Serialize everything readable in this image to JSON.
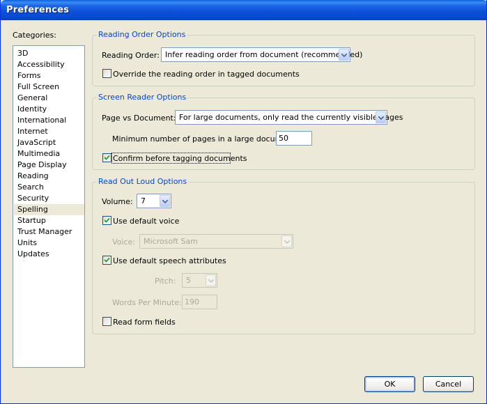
{
  "window": {
    "title": "Preferences"
  },
  "categories": {
    "label": "Categories:",
    "selected_index": 14,
    "items": [
      "3D",
      "Accessibility",
      "Forms",
      "Full Screen",
      "General",
      "Identity",
      "International",
      "Internet",
      "JavaScript",
      "Multimedia",
      "Page Display",
      "Reading",
      "Search",
      "Security",
      "Spelling",
      "Startup",
      "Trust Manager",
      "Units",
      "Updates"
    ]
  },
  "reading_order": {
    "group_title": "Reading Order Options",
    "label": "Reading Order:",
    "value": "Infer reading order from document (recommended)",
    "override_label": "Override the reading order in tagged documents",
    "override_checked": false
  },
  "screen_reader": {
    "group_title": "Screen Reader Options",
    "page_vs_doc_label": "Page vs Document:",
    "page_vs_doc_value": "For large documents, only read the currently visible pages",
    "min_pages_label": "Minimum number of pages in a large document:",
    "min_pages_value": "50",
    "confirm_label": "Confirm before tagging documents",
    "confirm_checked": true
  },
  "read_out_loud": {
    "group_title": "Read Out Loud Options",
    "volume_label": "Volume:",
    "volume_value": "7",
    "default_voice_label": "Use default voice",
    "default_voice_checked": true,
    "voice_label": "Voice:",
    "voice_value": "Microsoft Sam",
    "default_speech_label": "Use default speech attributes",
    "default_speech_checked": true,
    "pitch_label": "Pitch:",
    "pitch_value": "5",
    "wpm_label": "Words Per Minute:",
    "wpm_value": "190",
    "read_form_fields_label": "Read form fields",
    "read_form_fields_checked": false
  },
  "buttons": {
    "ok": "OK",
    "cancel": "Cancel"
  },
  "colors": {
    "title_bar": "#0a4fd6",
    "group_title": "#0046d5",
    "dialog_bg": "#ece9d8",
    "disabled_text": "#aca899"
  },
  "icons": {
    "dropdown": "chevron-down-icon",
    "check": "checkmark-icon"
  }
}
